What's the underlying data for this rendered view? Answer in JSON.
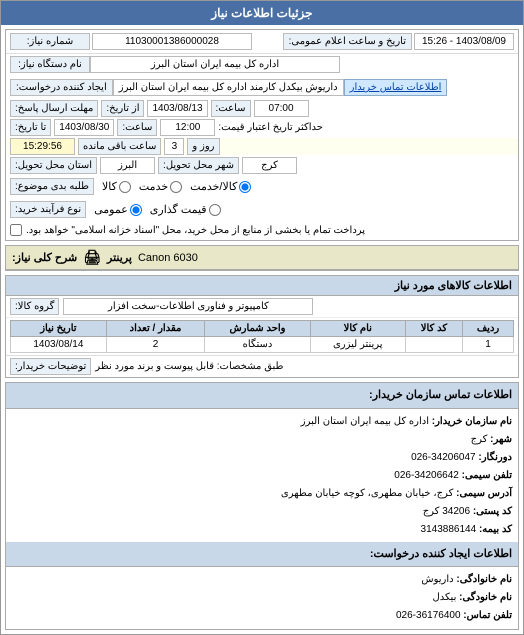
{
  "header": {
    "title": "جزئیات اطلاعات نیاز"
  },
  "top_info": {
    "order_number_label": "شماره نیاز:",
    "order_number_value": "11030001386000028",
    "date_label": "تاریخ و ساعت اعلام عمومی:",
    "date_value": "1403/08/09 - 15:26",
    "org_name_label": "نام دستگاه نیاز:",
    "org_name_value": "اداره کل بیمه ایران استان البرز",
    "supplier_label": "ایجاد کننده درخواست:",
    "supplier_value": "داریوش بیکدل کارمند  اداره کل بیمه ایران استان البرز",
    "supplier_link": "اطلاعات تماس خریدار",
    "send_time_label": "مهلت ارسال پاسخ:",
    "send_time_from_label": "از تاریخ:",
    "send_time_from": "1403/08/13",
    "send_time_from_hour_label": "ساعت:",
    "send_time_from_hour": "07:00",
    "send_time_to_label": "تا تاریخ:",
    "send_time_to": "1403/08/30",
    "send_time_to_hour_label": "ساعت:",
    "send_time_to_hour": "12:00",
    "remaining_label": "حداکثر تاریخ اعتبار قیمت:",
    "remaining_days": "3",
    "remaining_days_label": "روز و",
    "remaining_time": "15:29:56",
    "remaining_time_label": "ساعت باقی مانده",
    "delivery_label": "استان محل تحویل:",
    "delivery_value": "البرز",
    "city_label": "شهر محل تحویل:",
    "city_value": "کرج",
    "request_type_label": "طلبه بدی موضوع:",
    "request_type_options": [
      "کالا",
      "خدمت",
      "کالا/خدمت"
    ],
    "request_type_selected": "کالا/خدمت",
    "purchase_type_label": "نوع فرآیند خرید:",
    "purchase_type_options": [
      "عمومی",
      "قیمت گذاری",
      ""
    ],
    "purchase_checkbox_label": "پرداخت تمام یا بخشی از منابع از محل خرید، محل \"اسناد خزانه اسلامی\" خواهد بود."
  },
  "printer": {
    "section_label": "شرح کلی نیاز:",
    "printer_label": "پرینتر",
    "printer_value": "Canon 6030",
    "icon": "🖨"
  },
  "items": {
    "section_title": "اطلاعات کالاهای مورد نیاز",
    "group_label": "گروه کالا:",
    "group_value": "کامپیوتر و فناوری اطلاعات-سخت افزار",
    "columns": [
      "ردیف",
      "کد کالا",
      "نام کالا",
      "واحد شمارش",
      "مقدار / تعداد",
      "تاریخ نیاز"
    ],
    "rows": [
      {
        "row": "1",
        "code": "",
        "name": "پرینتر لیزری",
        "unit": "دستگاه",
        "qty": "2",
        "date": "1403/08/14"
      }
    ],
    "notes_label": "توضیحات خریدار:",
    "notes_value": "طبق مشخصات: قابل پیوست و برند مورد نظر"
  },
  "buyer_info": {
    "section_title": "اطلاعات تماس سازمان خریدار:",
    "name_label": "نام سازمان خریدار:",
    "name_value": "اداره کل بیمه ایران استان البرز",
    "city_label": "شهر:",
    "city_value": "کرج",
    "postal_label": "دورنگار:",
    "postal_value": "34206047-026",
    "fax_label": "تلفن سیمی:",
    "fax_value": "34206642-026",
    "address_label": "آدرس سیمی:",
    "address_value": "کرج، خیابان مطهری، کوچه خیابان مطهری",
    "zip_label": "کد پستی:",
    "zip_value": "34206 کرج",
    "code1_label": "کد بیمه:",
    "code1_value": "3143886144",
    "section2_title": "اطلاعات ایجاد کننده درخواست:",
    "req_name_label": "نام خانوادگی:",
    "req_name_value": "داریوش",
    "req_company_label": "نام خانودگی:",
    "req_company_value": "بیکدل",
    "req_phone_label": "تلفن تماس:",
    "req_phone_value": "36176400-026"
  }
}
